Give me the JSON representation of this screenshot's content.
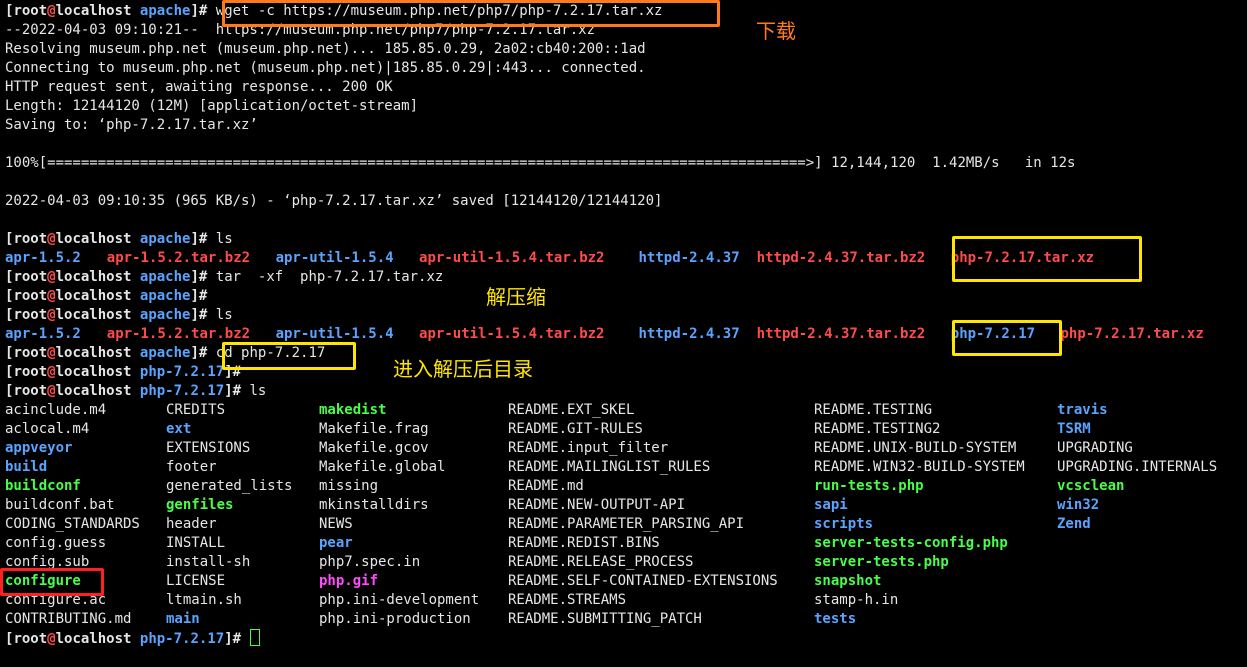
{
  "prompt_apache": {
    "user": "root",
    "at": "@",
    "host": "localhost",
    "dir": "apache"
  },
  "prompt_php": {
    "user": "root",
    "at": "@",
    "host": "localhost",
    "dir": "php-7.2.17"
  },
  "wget": {
    "cmd": "wget -c https://museum.php.net/php7/php-7.2.17.tar.xz",
    "out": [
      "--2022-04-03 09:10:21--  https://museum.php.net/php7/php-7.2.17.tar.xz",
      "Resolving museum.php.net (museum.php.net)... 185.85.0.29, 2a02:cb40:200::1ad",
      "Connecting to museum.php.net (museum.php.net)|185.85.0.29|:443... connected.",
      "HTTP request sent, awaiting response... 200 OK",
      "Length: 12144120 (12M) [application/octet-stream]",
      "Saving to: ‘php-7.2.17.tar.xz’",
      "",
      "100%[==========================================================================================>] 12,144,120  1.42MB/s   in 12s",
      "",
      "2022-04-03 09:10:35 (965 KB/s) - ‘php-7.2.17.tar.xz’ saved [12144120/12144120]",
      ""
    ]
  },
  "ls1": {
    "cmd": "ls",
    "items": [
      {
        "t": "apr-1.5.2",
        "c": "b"
      },
      {
        "t": "apr-1.5.2.tar.bz2",
        "c": "r"
      },
      {
        "t": "apr-util-1.5.4",
        "c": "b"
      },
      {
        "t": "apr-util-1.5.4.tar.bz2",
        "c": "r"
      },
      {
        "t": "httpd-2.4.37",
        "c": "b"
      },
      {
        "t": "httpd-2.4.37.tar.bz2",
        "c": "r"
      },
      {
        "t": "php-7.2.17.tar.xz",
        "c": "r"
      }
    ]
  },
  "tar": {
    "cmd": "tar  -xf  php-7.2.17.tar.xz"
  },
  "ls2": {
    "cmd": "ls",
    "items": [
      {
        "t": "apr-1.5.2",
        "c": "b"
      },
      {
        "t": "apr-1.5.2.tar.bz2",
        "c": "r"
      },
      {
        "t": "apr-util-1.5.4",
        "c": "b"
      },
      {
        "t": "apr-util-1.5.4.tar.bz2",
        "c": "r"
      },
      {
        "t": "httpd-2.4.37",
        "c": "b"
      },
      {
        "t": "httpd-2.4.37.tar.bz2",
        "c": "r"
      },
      {
        "t": "php-7.2.17",
        "c": "b"
      },
      {
        "t": "php-7.2.17.tar.xz",
        "c": "r"
      }
    ]
  },
  "cd": {
    "cmd": "cd php-7.2.17"
  },
  "ls3": {
    "cmd": "ls",
    "rows": [
      [
        {
          "t": "acinclude.m4",
          "c": ""
        },
        {
          "t": "CREDITS",
          "c": ""
        },
        {
          "t": "makedist",
          "c": "g"
        },
        {
          "t": "README.EXT_SKEL",
          "c": ""
        },
        {
          "t": "README.TESTING",
          "c": ""
        },
        {
          "t": "travis",
          "c": "b"
        }
      ],
      [
        {
          "t": "aclocal.m4",
          "c": ""
        },
        {
          "t": "ext",
          "c": "b"
        },
        {
          "t": "Makefile.frag",
          "c": ""
        },
        {
          "t": "README.GIT-RULES",
          "c": ""
        },
        {
          "t": "README.TESTING2",
          "c": ""
        },
        {
          "t": "TSRM",
          "c": "b"
        }
      ],
      [
        {
          "t": "appveyor",
          "c": "b"
        },
        {
          "t": "EXTENSIONS",
          "c": ""
        },
        {
          "t": "Makefile.gcov",
          "c": ""
        },
        {
          "t": "README.input_filter",
          "c": ""
        },
        {
          "t": "README.UNIX-BUILD-SYSTEM",
          "c": ""
        },
        {
          "t": "UPGRADING",
          "c": ""
        }
      ],
      [
        {
          "t": "build",
          "c": "b"
        },
        {
          "t": "footer",
          "c": ""
        },
        {
          "t": "Makefile.global",
          "c": ""
        },
        {
          "t": "README.MAILINGLIST_RULES",
          "c": ""
        },
        {
          "t": "README.WIN32-BUILD-SYSTEM",
          "c": ""
        },
        {
          "t": "UPGRADING.INTERNALS",
          "c": ""
        }
      ],
      [
        {
          "t": "buildconf",
          "c": "g"
        },
        {
          "t": "generated_lists",
          "c": ""
        },
        {
          "t": "missing",
          "c": ""
        },
        {
          "t": "README.md",
          "c": ""
        },
        {
          "t": "run-tests.php",
          "c": "g"
        },
        {
          "t": "vcsclean",
          "c": "g"
        }
      ],
      [
        {
          "t": "buildconf.bat",
          "c": ""
        },
        {
          "t": "genfiles",
          "c": "g"
        },
        {
          "t": "mkinstalldirs",
          "c": ""
        },
        {
          "t": "README.NEW-OUTPUT-API",
          "c": ""
        },
        {
          "t": "sapi",
          "c": "b"
        },
        {
          "t": "win32",
          "c": "b"
        }
      ],
      [
        {
          "t": "CODING_STANDARDS",
          "c": ""
        },
        {
          "t": "header",
          "c": ""
        },
        {
          "t": "NEWS",
          "c": ""
        },
        {
          "t": "README.PARAMETER_PARSING_API",
          "c": ""
        },
        {
          "t": "scripts",
          "c": "b"
        },
        {
          "t": "Zend",
          "c": "b"
        }
      ],
      [
        {
          "t": "config.guess",
          "c": ""
        },
        {
          "t": "INSTALL",
          "c": ""
        },
        {
          "t": "pear",
          "c": "b"
        },
        {
          "t": "README.REDIST.BINS",
          "c": ""
        },
        {
          "t": "server-tests-config.php",
          "c": "g"
        },
        {
          "t": "",
          "c": ""
        }
      ],
      [
        {
          "t": "config.sub",
          "c": ""
        },
        {
          "t": "install-sh",
          "c": ""
        },
        {
          "t": "php7.spec.in",
          "c": ""
        },
        {
          "t": "README.RELEASE_PROCESS",
          "c": ""
        },
        {
          "t": "server-tests.php",
          "c": "g"
        },
        {
          "t": "",
          "c": ""
        }
      ],
      [
        {
          "t": "configure",
          "c": "g"
        },
        {
          "t": "LICENSE",
          "c": ""
        },
        {
          "t": "php.gif",
          "c": "m"
        },
        {
          "t": "README.SELF-CONTAINED-EXTENSIONS",
          "c": ""
        },
        {
          "t": "snapshot",
          "c": "g"
        },
        {
          "t": "",
          "c": ""
        }
      ],
      [
        {
          "t": "configure.ac",
          "c": ""
        },
        {
          "t": "ltmain.sh",
          "c": ""
        },
        {
          "t": "php.ini-development",
          "c": ""
        },
        {
          "t": "README.STREAMS",
          "c": ""
        },
        {
          "t": "stamp-h.in",
          "c": ""
        },
        {
          "t": "",
          "c": ""
        }
      ],
      [
        {
          "t": "CONTRIBUTING.md",
          "c": ""
        },
        {
          "t": "main",
          "c": "b"
        },
        {
          "t": "php.ini-production",
          "c": ""
        },
        {
          "t": "README.SUBMITTING_PATCH",
          "c": ""
        },
        {
          "t": "tests",
          "c": "b"
        },
        {
          "t": "",
          "c": ""
        }
      ]
    ]
  },
  "annotations": {
    "download": "下载",
    "extract": "解压缩",
    "enter_dir": "进入解压后目录"
  },
  "colors": {
    "orange": "#ff7a1a",
    "yellow": "#ffe600",
    "red": "#ff2020"
  }
}
